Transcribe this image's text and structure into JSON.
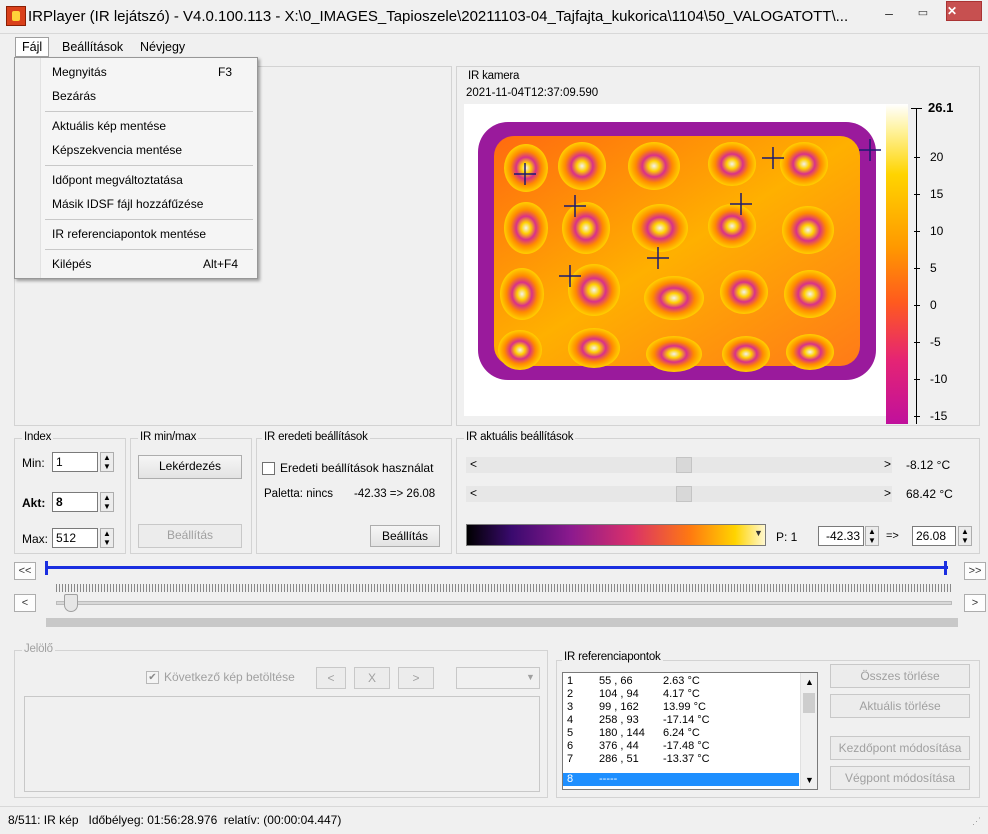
{
  "window": {
    "title": "IRPlayer (IR lejátszó) - V4.0.100.113 - X:\\0_IMAGES_Tapioszele\\20211103-04_Tajfajta_kukorica\\1104\\50_VALOGATOTT\\...",
    "minimize": "–",
    "maximize": "▭",
    "close": "✕"
  },
  "menu": {
    "items": [
      "Fájl",
      "Beállítások",
      "Névjegy"
    ],
    "file_dropdown": [
      {
        "label": "Megnyitás",
        "shortcut": "F3"
      },
      {
        "label": "Bezárás",
        "shortcut": ""
      },
      {
        "label": "Aktuális kép mentése",
        "shortcut": ""
      },
      {
        "label": "Képszekvencia mentése",
        "shortcut": ""
      },
      {
        "label": "Időpont megváltoztatása",
        "shortcut": ""
      },
      {
        "label": "Másik IDSF fájl hozzáfűzése",
        "shortcut": ""
      },
      {
        "label": "IR referenciapontok mentése",
        "shortcut": ""
      },
      {
        "label": "Kilépés",
        "shortcut": "Alt+F4"
      }
    ]
  },
  "ir_camera": {
    "title": "IR kamera",
    "timestamp": "2021-11-04T12:37:09.590",
    "scale_max": "26.1",
    "scale_ticks": [
      "20",
      "15",
      "10",
      "5",
      "0",
      "-5",
      "-10",
      "-15"
    ]
  },
  "index_panel": {
    "title": "Index",
    "min_label": "Min:",
    "min_value": "1",
    "akt_label": "Akt:",
    "akt_value": "8",
    "max_label": "Max:",
    "max_value": "512"
  },
  "minmax_panel": {
    "title": "IR min/max",
    "query_button": "Lekérdezés",
    "set_button": "Beállítás"
  },
  "original_panel": {
    "title": "IR eredeti beállítások",
    "checkbox_label": "Eredeti beállítások használat",
    "palette_label": "Paletta: nincs",
    "range_text": "-42.33 => 26.08",
    "set_button": "Beállítás"
  },
  "current_panel": {
    "title": "IR aktuális beállítások",
    "slider1_value": "-8.12 °C",
    "slider2_value": "68.42 °C",
    "palette_p": "P: 1",
    "min_value": "-42.33",
    "arrow": "=>",
    "max_value": "26.08"
  },
  "playback": {
    "rewind": "<<",
    "forward": ">>",
    "step_back": "<",
    "step_forward": ">"
  },
  "marker_panel": {
    "title": "Jelölő",
    "next_checkbox": "Következő kép betöltése",
    "prev_btn": "<",
    "x_btn": "X",
    "next_btn": ">"
  },
  "ref_panel": {
    "title": "IR referenciapontok",
    "rows": [
      {
        "n": "1",
        "xy": "55 , 66",
        "t": "2.63 °C"
      },
      {
        "n": "2",
        "xy": "104 , 94",
        "t": "4.17 °C"
      },
      {
        "n": "3",
        "xy": "99 , 162",
        "t": "13.99 °C"
      },
      {
        "n": "4",
        "xy": "258 , 93",
        "t": "-17.14 °C"
      },
      {
        "n": "5",
        "xy": "180 , 144",
        "t": "6.24 °C"
      },
      {
        "n": "6",
        "xy": "376 , 44",
        "t": "-17.48 °C"
      },
      {
        "n": "7",
        "xy": "286 , 51",
        "t": "-13.37 °C"
      },
      {
        "n": "8",
        "xy": "-----",
        "t": ""
      }
    ],
    "btn_delete_all": "Összes törlése",
    "btn_delete_current": "Aktuális törlése",
    "btn_edit_start": "Kezdőpont módosítása",
    "btn_edit_end": "Végpont módosítása"
  },
  "status": {
    "text": "8/511: IR kép   Időbélyeg: 01:56:28.976  relatív: (00:00:04.447)"
  },
  "colors": {
    "ir_dark": "#7a0c8c",
    "ir_hot": "#ffd200",
    "accent_blue": "#1a2ee0",
    "selection": "#1e8fff"
  }
}
